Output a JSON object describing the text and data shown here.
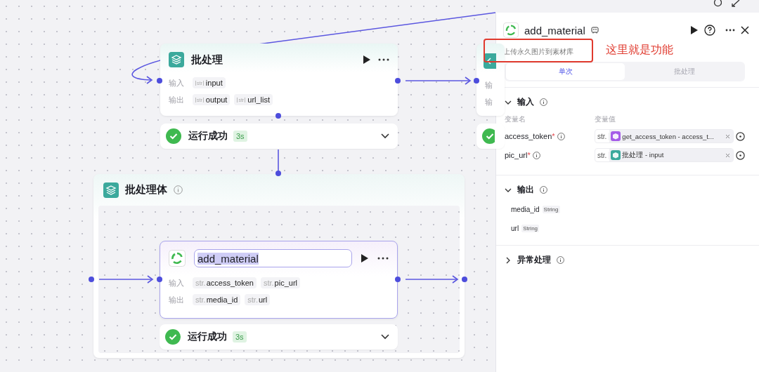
{
  "batch_node": {
    "title": "批处理",
    "inputs_label": "输入",
    "inputs": [
      {
        "type": "str",
        "name": "input"
      }
    ],
    "outputs_label": "输出",
    "outputs": [
      {
        "type": "str",
        "name": "output"
      },
      {
        "type": "str",
        "name": "url_list"
      }
    ],
    "status": {
      "text": "运行成功",
      "duration": "3s",
      "success": true
    }
  },
  "partial_node": {
    "inputs_label": "输",
    "outputs_label": "输",
    "status": {
      "success": true
    }
  },
  "batch_body": {
    "title": "批处理体",
    "node": {
      "title": "add_material",
      "editing": true,
      "inputs_label": "输入",
      "inputs": [
        {
          "type": "str.",
          "name": "access_token"
        },
        {
          "type": "str.",
          "name": "pic_url"
        }
      ],
      "outputs_label": "输出",
      "outputs": [
        {
          "type": "str.",
          "name": "media_id"
        },
        {
          "type": "str.",
          "name": "url"
        }
      ],
      "status": {
        "text": "运行成功",
        "duration": "3s",
        "success": true
      }
    }
  },
  "panel": {
    "title": "add_material",
    "description": "上传永久图片到素材库",
    "annotation": "这里就是功能",
    "tabs": [
      {
        "label": "单次",
        "selected": true
      },
      {
        "label": "批处理",
        "selected": false
      }
    ],
    "input_section": {
      "title": "输入",
      "expanded": true,
      "col_name": "变量名",
      "col_value": "变量值",
      "rows": [
        {
          "name": "access_token",
          "required_mark": "*",
          "type": "str.",
          "color": "#a55ce8",
          "ref": "get_access_token - access_t..."
        },
        {
          "name": "pic_url",
          "required_mark": "*",
          "type": "str.",
          "color": "#3ba99c",
          "ref": "批处理 - input"
        }
      ]
    },
    "output_section": {
      "title": "输出",
      "expanded": true,
      "rows": [
        {
          "name": "media_id",
          "type": "String"
        },
        {
          "name": "url",
          "type": "String"
        }
      ]
    },
    "error_section": {
      "title": "异常处理",
      "expanded": false
    }
  }
}
